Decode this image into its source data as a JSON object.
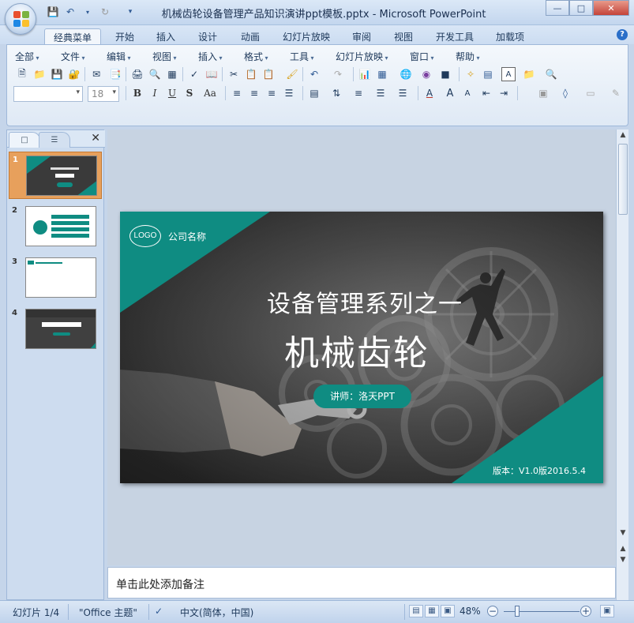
{
  "window": {
    "title": "机械齿轮设备管理产品知识演讲ppt模板.pptx - Microsoft PowerPoint"
  },
  "ribbon_tabs": [
    {
      "label": "经典菜单",
      "active": true
    },
    {
      "label": "开始"
    },
    {
      "label": "插入"
    },
    {
      "label": "设计"
    },
    {
      "label": "动画"
    },
    {
      "label": "幻灯片放映"
    },
    {
      "label": "审阅"
    },
    {
      "label": "视图"
    },
    {
      "label": "开发工具"
    },
    {
      "label": "加载项"
    }
  ],
  "menu": {
    "items": [
      "全部",
      "文件",
      "编辑",
      "视图",
      "插入",
      "格式",
      "工具",
      "幻灯片放映",
      "窗口",
      "帮助"
    ]
  },
  "toolbar": {
    "font_size": "18",
    "font_name": "",
    "bold": "B",
    "italic": "I",
    "underline": "U",
    "shadow": "S",
    "change_case": "Aa"
  },
  "slides_panel": {
    "slides": [
      {
        "number": "1",
        "selected": true
      },
      {
        "number": "2"
      },
      {
        "number": "3"
      },
      {
        "number": "4"
      }
    ]
  },
  "slide": {
    "logo_text": "LOGO",
    "company_name": "公司名称",
    "subtitle": "设备管理系列之一",
    "title": "机械齿轮",
    "lecturer": "讲师：洛天PPT",
    "version": "版本：V1.0版2016.5.4",
    "accent_color": "#0f8c82"
  },
  "notes": {
    "placeholder": "单击此处添加备注"
  },
  "status": {
    "slide_counter": "幻灯片 1/4",
    "theme": "\"Office 主题\"",
    "language": "中文(简体，中国)",
    "zoom": "48%",
    "zoom_fraction": 0.48
  }
}
